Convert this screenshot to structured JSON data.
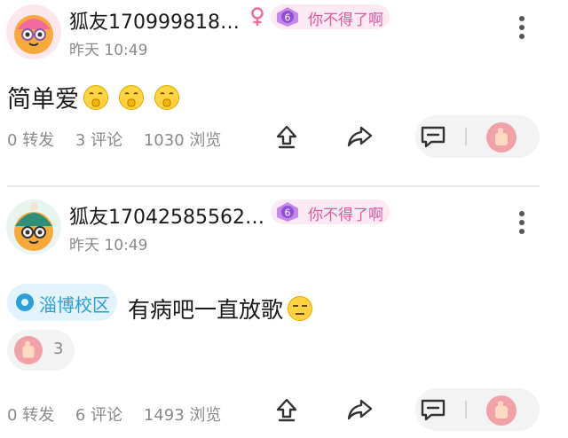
{
  "posts": [
    {
      "username": "狐友170999818…",
      "time": "昨天 10:49",
      "level_num": "6",
      "level_title": "你不得了啊",
      "content": "简单爱",
      "emoji_count": 3,
      "stats": {
        "reposts": "0",
        "reposts_label": "转发",
        "comments": "3",
        "comments_label": "评论",
        "views": "1030",
        "views_label": "浏览"
      }
    },
    {
      "username": "狐友17042585562…",
      "time": "昨天 10:49",
      "level_num": "6",
      "level_title": "你不得了啊",
      "tag": "淄博校区",
      "content": "有病吧一直放歌",
      "likes": "3",
      "stats": {
        "reposts": "0",
        "reposts_label": "转发",
        "comments": "6",
        "comments_label": "评论",
        "views": "1493",
        "views_label": "浏览"
      }
    }
  ],
  "icons": {
    "gender": "female-icon",
    "level": "level-gem-icon",
    "more": "more-vertical-icon",
    "share": "share-up-icon",
    "forward": "forward-arrow-icon",
    "comment": "comment-icon",
    "like": "thumbs-up-icon"
  },
  "colors": {
    "accent_pink": "#e5579a",
    "tag_blue": "#2a9fd8",
    "meta_gray": "#8a8a8a"
  }
}
